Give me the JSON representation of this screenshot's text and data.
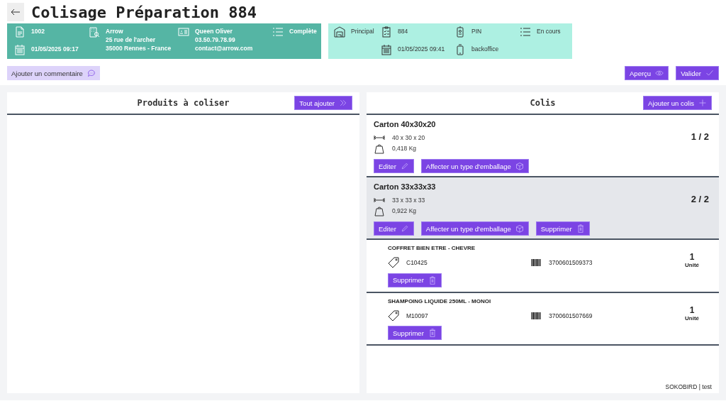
{
  "title": "Colisage Préparation 884",
  "order_panel": {
    "number": "1002",
    "date": "01/05/2025 09:17",
    "customer": [
      "Arrow",
      "25 rue de l'archer",
      "35000 Rennes - France"
    ],
    "contact": [
      "Queen Oliver",
      "03.50.79.78.99",
      "contact@arrow.com"
    ],
    "status": "Complète"
  },
  "prep_panel": {
    "warehouse": "Principal",
    "number": "884",
    "date": "01/05/2025 09:41",
    "pin": "PIN",
    "device": "backoffice",
    "status": "En cours"
  },
  "comment_button": "Ajouter un commentaire",
  "actions": [
    {
      "label": "Aperçu",
      "kind": "preview"
    },
    {
      "label": "Valider",
      "kind": "validate"
    }
  ],
  "products_panel": {
    "title": "Produits à coliser",
    "button": "Tout ajouter"
  },
  "colis_panel": {
    "title": "Colis",
    "button": "Ajouter un colis",
    "packages": [
      {
        "name": "Carton 40x30x20",
        "dimensions": "40 x 30 x 20",
        "weight": "0,418 Kg",
        "count": "1 / 2",
        "selected": false,
        "buttons": [
          {
            "label": "Editer",
            "kind": "edit"
          },
          {
            "label": "Affecter un type d'emballage",
            "kind": "pack"
          }
        ]
      },
      {
        "name": "Carton 33x33x33",
        "dimensions": "33 x 33 x 33",
        "weight": "0,922 Kg",
        "count": "2 / 2",
        "selected": true,
        "buttons": [
          {
            "label": "Editer",
            "kind": "edit"
          },
          {
            "label": "Affecter un type d'emballage",
            "kind": "pack"
          },
          {
            "label": "Supprimer",
            "kind": "delete"
          }
        ],
        "items": [
          {
            "name": "COFFRET BIEN ETRE - CHEVRE",
            "ref": "C10425",
            "barcode": "3700601509373",
            "qty": "1",
            "unit": "Unité",
            "button": "Supprimer"
          },
          {
            "name": "SHAMPOING LIQUIDE 250ML - MONOI",
            "ref": "M10097",
            "barcode": "3700601507669",
            "qty": "1",
            "unit": "Unité",
            "button": "Supprimer"
          }
        ]
      }
    ]
  },
  "footer": "SOKOBIRD | test"
}
